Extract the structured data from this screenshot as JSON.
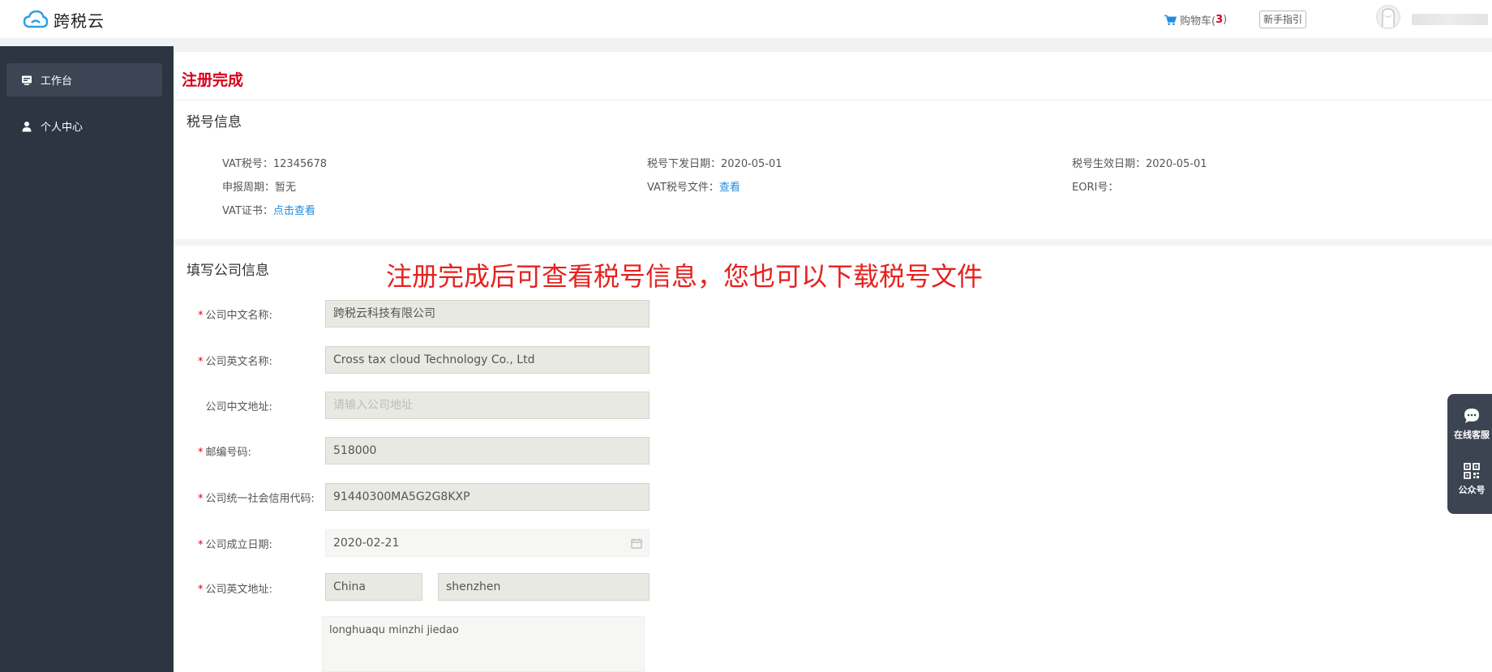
{
  "header": {
    "brand": "跨税云",
    "cart_label": "购物车(",
    "cart_count": "3",
    "cart_close": ")",
    "guide_label": "新手指引"
  },
  "sidebar": {
    "items": [
      {
        "label": "工作台",
        "icon": "workbench-icon",
        "active": true
      },
      {
        "label": "个人中心",
        "icon": "user-icon",
        "active": false
      }
    ]
  },
  "page": {
    "title": "注册完成",
    "annotation": "注册完成后可查看税号信息，您也可以下载税号文件"
  },
  "tax_info": {
    "section_title": "税号信息",
    "vat_no_label": "VAT税号：",
    "vat_no_value": "12345678",
    "issue_date_label": "税号下发日期：",
    "issue_date_value": "2020-05-01",
    "effective_date_label": "税号生效日期：",
    "effective_date_value": "2020-05-01",
    "period_label": "申报周期：",
    "period_value": "暂无",
    "vat_file_label": "VAT税号文件：",
    "vat_file_link": "查看",
    "eori_label": "EORI号：",
    "vat_cert_label": "VAT证书：",
    "vat_cert_link": "点击查看"
  },
  "company_form": {
    "section_title": "填写公司信息",
    "cn_name_label": "公司中文名称:",
    "cn_name_value": "跨税云科技有限公司",
    "en_name_label": "公司英文名称:",
    "en_name_value": "Cross tax cloud Technology Co., Ltd",
    "cn_address_label": "公司中文地址:",
    "cn_address_placeholder": "请输入公司地址",
    "postcode_label": "邮编号码:",
    "postcode_value": "518000",
    "credit_code_label": "公司统一社会信用代码:",
    "credit_code_value": "91440300MA5G2G8KXP",
    "founded_label": "公司成立日期:",
    "founded_value": "2020-02-21",
    "en_address_label": "公司英文地址:",
    "country_value": "China",
    "city_value": "shenzhen",
    "street_value": "longhuaqu minzhi jiedao"
  },
  "float_panel": {
    "service_label": "在线客服",
    "wechat_label": "公众号"
  },
  "colors": {
    "accent_red": "#d9001b",
    "link_blue": "#1f8ce4",
    "sidebar_bg": "#2c3541",
    "annotation_red": "#e5221f"
  }
}
